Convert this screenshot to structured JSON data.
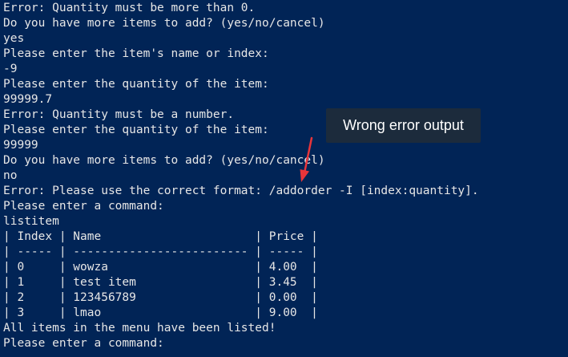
{
  "terminal": {
    "lines": [
      "Error: Quantity must be more than 0.",
      "Do you have more items to add? (yes/no/cancel)",
      "yes",
      "Please enter the item's name or index:",
      "-9",
      "Please enter the quantity of the item:",
      "99999.7",
      "Error: Quantity must be a number.",
      "Please enter the quantity of the item:",
      "99999",
      "Do you have more items to add? (yes/no/cancel)",
      "no",
      "Error: Please use the correct format: /addorder -I [index:quantity].",
      "Please enter a command:",
      "listitem",
      "| Index | Name                      | Price |",
      "| ----- | ------------------------- | ----- |",
      "| 0     | wowza                     | 4.00  |",
      "| 1     | test item                 | 3.45  |",
      "| 2     | 123456789                 | 0.00  |",
      "| 3     | lmao                      | 9.00  |",
      "All items in the menu have been listed!",
      "Please enter a command:"
    ]
  },
  "annotation": {
    "text": "Wrong error output",
    "arrow_color": "#e8353a"
  },
  "colors": {
    "background": "#012456",
    "text": "#e6e6e6",
    "annotation_bg": "#1c2b3c"
  }
}
